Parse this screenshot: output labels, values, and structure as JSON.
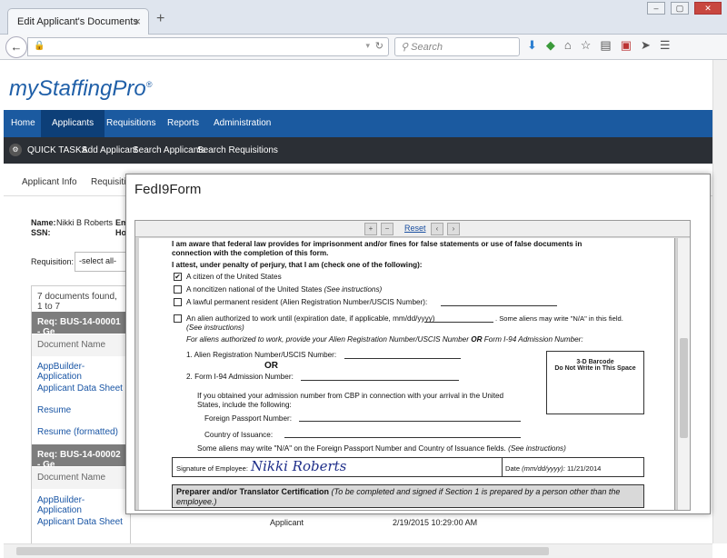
{
  "browser": {
    "tab_title": "Edit Applicant's Documents",
    "tab_close": "×",
    "new_tab": "+",
    "search_placeholder": "Search",
    "window_controls": [
      "–",
      "▢",
      "✕"
    ]
  },
  "app": {
    "logo": "myStaffingPro",
    "logo_mark": "®",
    "main_nav": [
      "Home",
      "Applicants",
      "Requisitions",
      "Reports",
      "Administration"
    ],
    "main_nav_active": "Applicants",
    "sub_nav": [
      "QUICK TASKS",
      "Add Applicant",
      "Search Applicants",
      "Search Requisitions"
    ],
    "subtabs": [
      "Applicant Info",
      "Requisition"
    ],
    "applicant": {
      "name_label": "Name:",
      "name_value": "Nikki B Roberts",
      "ssn_label": "SSN:",
      "em_label": "Em",
      "ho_label": "Ho"
    },
    "requisition_label": "Requisition:",
    "requisition_select": "-select all-",
    "docs_found": "7 documents found, 1 to 7",
    "list": [
      {
        "text": "Req: BUS-14-00001 - Ge",
        "kind": "group"
      },
      {
        "text": "Document Name",
        "kind": "header"
      },
      {
        "text": "AppBuilder-Application",
        "kind": "link"
      },
      {
        "text": "Applicant Data Sheet",
        "kind": "link"
      },
      {
        "text": "Resume",
        "kind": "link"
      },
      {
        "text": "Resume (formatted)",
        "kind": "link"
      },
      {
        "text": "Req: BUS-14-00002 - Ge",
        "kind": "group"
      },
      {
        "text": "Document Name",
        "kind": "header"
      },
      {
        "text": "AppBuilder-Application",
        "kind": "link"
      },
      {
        "text": "Applicant Data Sheet",
        "kind": "link"
      }
    ],
    "last_row": {
      "type": "Applicant",
      "date": "2/19/2015 10:29:00 AM"
    }
  },
  "modal": {
    "title": "FedI9Form",
    "toolbar": {
      "zoom_in": "+",
      "zoom_out": "−",
      "reset": "Reset",
      "prev": "‹",
      "next": "›"
    },
    "form": {
      "line1": "I am aware that federal law provides for imprisonment and/or fines for false statements or use of false documents in",
      "line2": "connection with the completion of this form.",
      "attest": "I attest, under penalty of perjury, that I am (check one of the following):",
      "opt1": "A citizen of the United States",
      "opt1_checked": "✔",
      "opt2": "A noncitizen national of the United States ",
      "opt2_note": "(See instructions)",
      "opt3": "A lawful permanent resident (Alien Registration Number/USCIS Number):",
      "opt4": "An alien authorized to work until (expiration date, if applicable, mm/dd/yyyy)",
      "opt4_tail": ". Some aliens may write \"N/A\" in this field.",
      "opt4_note": "(See instructions)",
      "for_aliens": "For aliens authorized to work, provide your Alien Registration Number/USCIS Number ",
      "for_aliens_or": "OR",
      "for_aliens_tail": " Form I-94 Admission Number:",
      "item1": "1. Alien Registration Number/USCIS Number:",
      "or": "OR",
      "item2": "2. Form I-94 Admission Number:",
      "cbp1": "If you obtained your admission number from CBP in connection with your arrival in the United",
      "cbp2": "States, include the following:",
      "passport": "Foreign Passport Number:",
      "country": "Country of Issuance:",
      "na_note": "Some aliens may write \"N/A\" on the Foreign Passport Number and Country of Issuance fields. ",
      "na_note_i": "(See instructions)",
      "barcode1": "3-D Barcode",
      "barcode2": "Do Not Write in This Space",
      "sig_label": "Signature of Employee:",
      "signature": "Nikki Roberts",
      "date_label": "Date ",
      "date_fmt": "(mm/dd/yyyy):",
      "date_value": "11/21/2014",
      "prep_title": "Preparer and/or Translator Certification",
      "prep_note1": " (To be completed and signed if Section 1 is prepared by a person other than the",
      "prep_note2": "employee.)"
    }
  },
  "colors": {
    "nav": "#1b5aa0",
    "nav_active": "#0d3f78",
    "subnav": "#2b2f35",
    "link": "#1a56a5",
    "group_row": "#7d7d7d"
  }
}
